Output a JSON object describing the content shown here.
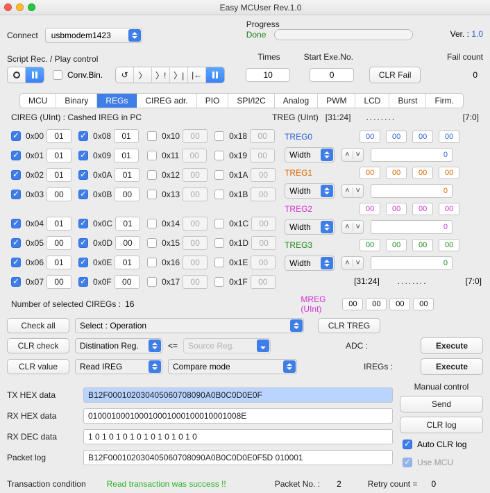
{
  "window_title": "Easy MCUser Rev.1.0",
  "connect_label": "Connect",
  "connect_value": "usbmodem1423",
  "progress_label": "Progress",
  "progress_status": "Done",
  "version_label": "Ver. :",
  "version_value": "1.0",
  "script_label": "Script Rec. / Play control",
  "conv_bin_label": "Conv.Bin.",
  "times_label": "Times",
  "times_value": "10",
  "start_label": "Start Exe.No.",
  "start_value": "0",
  "clr_fail_label": "CLR Fail",
  "fail_count_label": "Fail count",
  "fail_count_value": "0",
  "play_icons": [
    "↺",
    "〉",
    "〉!",
    "〉|",
    "|←"
  ],
  "tabs": [
    "MCU",
    "Binary",
    "REGs",
    "CIREG adr.",
    "PIO",
    "SPI/I2C",
    "Analog",
    "PWM",
    "LCD",
    "Burst",
    "Firm."
  ],
  "cireg_header": "CIREG (UInt) : Cashed IREG in PC",
  "cireg_left": [
    {
      "addr": "0x00",
      "val": "01",
      "c": true
    },
    {
      "addr": "0x01",
      "val": "01",
      "c": true
    },
    {
      "addr": "0x02",
      "val": "01",
      "c": true
    },
    {
      "addr": "0x03",
      "val": "00",
      "c": true
    }
  ],
  "cireg_left2": [
    {
      "addr": "0x04",
      "val": "01",
      "c": true
    },
    {
      "addr": "0x05",
      "val": "00",
      "c": true
    },
    {
      "addr": "0x06",
      "val": "01",
      "c": true
    },
    {
      "addr": "0x07",
      "val": "00",
      "c": true
    }
  ],
  "cireg_mid": [
    {
      "addr": "0x08",
      "val": "01",
      "c": true
    },
    {
      "addr": "0x09",
      "val": "01",
      "c": true
    },
    {
      "addr": "0x0A",
      "val": "01",
      "c": true
    },
    {
      "addr": "0x0B",
      "val": "00",
      "c": true
    }
  ],
  "cireg_mid2": [
    {
      "addr": "0x0C",
      "val": "01",
      "c": true
    },
    {
      "addr": "0x0D",
      "val": "00",
      "c": true
    },
    {
      "addr": "0x0E",
      "val": "01",
      "c": true
    },
    {
      "addr": "0x0F",
      "val": "00",
      "c": true
    }
  ],
  "cireg_r1": [
    {
      "addr": "0x10",
      "val": "00"
    },
    {
      "addr": "0x11",
      "val": "00"
    },
    {
      "addr": "0x12",
      "val": "00"
    },
    {
      "addr": "0x13",
      "val": "00"
    }
  ],
  "cireg_r12": [
    {
      "addr": "0x14",
      "val": "00"
    },
    {
      "addr": "0x15",
      "val": "00"
    },
    {
      "addr": "0x16",
      "val": "00"
    },
    {
      "addr": "0x17",
      "val": "00"
    }
  ],
  "cireg_r2": [
    {
      "addr": "0x18",
      "val": "00"
    },
    {
      "addr": "0x19",
      "val": "00"
    },
    {
      "addr": "0x1A",
      "val": "00"
    },
    {
      "addr": "0x1B",
      "val": "00"
    }
  ],
  "cireg_r22": [
    {
      "addr": "0x1C",
      "val": "00"
    },
    {
      "addr": "0x1D",
      "val": "00"
    },
    {
      "addr": "0x1E",
      "val": "00"
    },
    {
      "addr": "0x1F",
      "val": "00"
    }
  ],
  "num_selected_label": "Number of selected CIREGs :",
  "num_selected": "16",
  "check_all": "Check all",
  "select_operation": "Select : Operation",
  "clr_check": "CLR check",
  "dest_reg": "Distination Reg.",
  "lte": "<=",
  "src_reg": "Source Reg.",
  "clr_value": "CLR value",
  "read_ireg": "Read IREG",
  "compare_mode": "Compare mode",
  "treg_header": "TREG (UInt)",
  "treg_colhead_hi": "[31:24]",
  "treg_colhead_lo": "[7:0]",
  "treg_dots": "........",
  "treg0": {
    "name": "TREG0",
    "b": [
      "00",
      "00",
      "00",
      "00"
    ],
    "wide": "0"
  },
  "treg1": {
    "name": "TREG1",
    "b": [
      "00",
      "00",
      "00",
      "00"
    ],
    "wide": "0"
  },
  "treg2": {
    "name": "TREG2",
    "b": [
      "00",
      "00",
      "00",
      "00"
    ],
    "wide": "0"
  },
  "treg3": {
    "name": "TREG3",
    "b": [
      "00",
      "00",
      "00",
      "00"
    ],
    "wide": "0"
  },
  "width_label": "Width",
  "mreg_label": "MREG (UInt)",
  "mreg_b": [
    "00",
    "00",
    "00",
    "00"
  ],
  "clr_treg": "CLR TREG",
  "adc_label": "ADC :",
  "iregs_label": "IREGs :",
  "execute": "Execute",
  "manual_label": "Manual control",
  "send_label": "Send",
  "clr_log_label": "CLR log",
  "auto_clr_log": "Auto CLR log",
  "use_mcu": "Use MCU",
  "tx_label": "TX HEX data",
  "tx_val": "B12F000102030405060708090A0B0C0D0E0F",
  "rx_label": "RX HEX data",
  "rx_val": "010001000100010001000100010001008E",
  "rxd_label": "RX DEC data",
  "rxd_val": "1 0 1 0 1 0 1 0 1 0 1 0 1 0 1 0",
  "pkt_label": "Packet log",
  "pkt_val": "B12F000102030405060708090A0B0C0D0E0F5D 010001",
  "trans_label": "Transaction condition",
  "trans_status": "Read transaction was success !!",
  "packet_no_label": "Packet No. :",
  "packet_no": "2",
  "retry_label": "Retry count  =",
  "retry_val": "0"
}
